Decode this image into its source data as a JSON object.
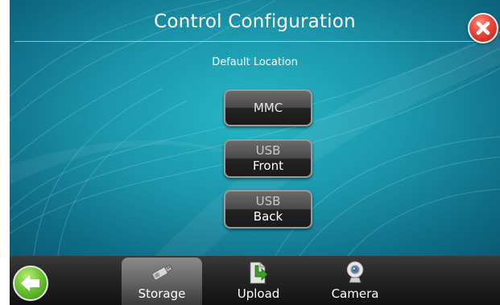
{
  "header": {
    "title": "Control Configuration",
    "close_icon": "close-icon"
  },
  "section": {
    "label": "Default Location"
  },
  "options": [
    {
      "line1": "MMC",
      "line2": ""
    },
    {
      "line1": "USB",
      "line2": "Front"
    },
    {
      "line1": "USB",
      "line2": "Back"
    }
  ],
  "tabs": [
    {
      "label": "Storage",
      "icon": "usb-drive-icon",
      "active": true
    },
    {
      "label": "Upload",
      "icon": "upload-icon",
      "active": false
    },
    {
      "label": "Camera",
      "icon": "webcam-icon",
      "active": false
    }
  ],
  "nav": {
    "back_icon": "back-arrow-icon"
  },
  "colors": {
    "background": "#1b95ab",
    "close": "#e8453a",
    "back": "#6cc431",
    "bar": "#262626"
  }
}
